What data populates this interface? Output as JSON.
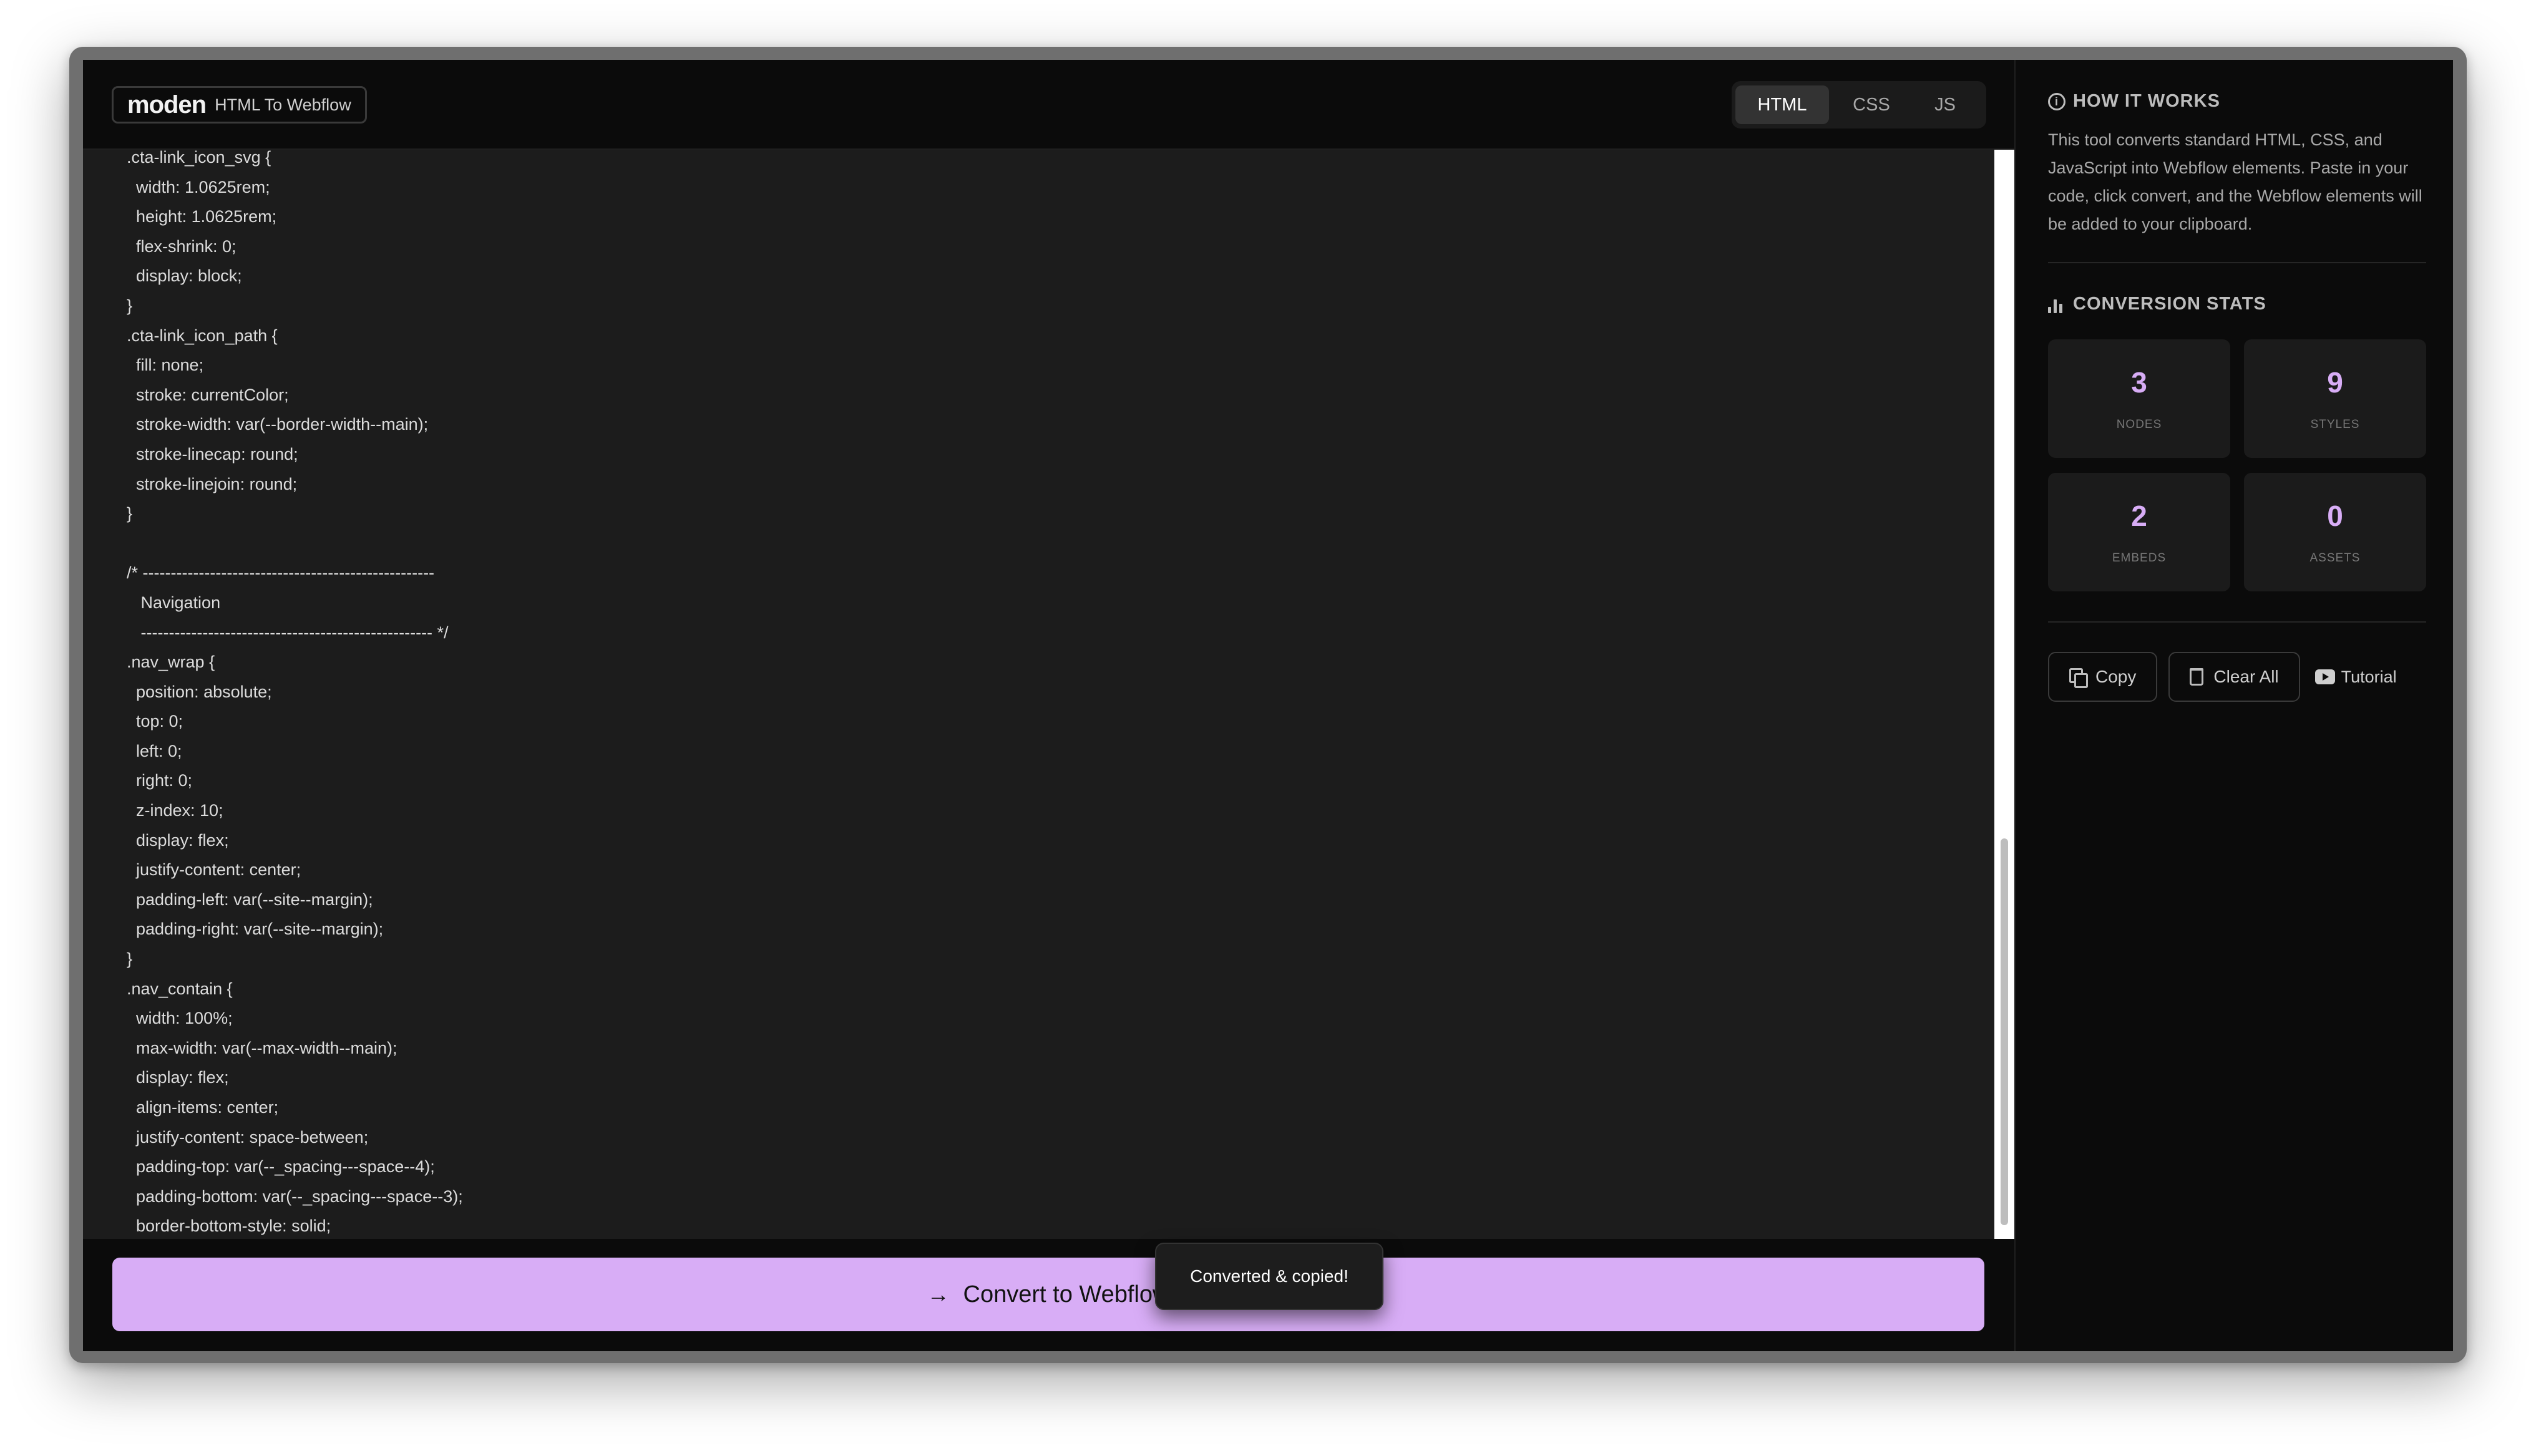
{
  "brand": {
    "logo": "moden",
    "subtitle": "HTML To Webflow"
  },
  "tabs": [
    {
      "label": "HTML",
      "active": true
    },
    {
      "label": "CSS",
      "active": false
    },
    {
      "label": "JS",
      "active": false
    }
  ],
  "editor": {
    "code": ".cta-link_icon_svg {\n  width: 1.0625rem;\n  height: 1.0625rem;\n  flex-shrink: 0;\n  display: block;\n}\n.cta-link_icon_path {\n  fill: none;\n  stroke: currentColor;\n  stroke-width: var(--border-width--main);\n  stroke-linecap: round;\n  stroke-linejoin: round;\n}\n\n/* ----------------------------------------------------\n   Navigation\n   ---------------------------------------------------- */\n.nav_wrap {\n  position: absolute;\n  top: 0;\n  left: 0;\n  right: 0;\n  z-index: 10;\n  display: flex;\n  justify-content: center;\n  padding-left: var(--site--margin);\n  padding-right: var(--site--margin);\n}\n.nav_contain {\n  width: 100%;\n  max-width: var(--max-width--main);\n  display: flex;\n  align-items: center;\n  justify-content: space-between;\n  padding-top: var(--_spacing---space--4);\n  padding-bottom: var(--_spacing---space--3);\n  border-bottom-style: solid;"
  },
  "convert_button": {
    "label": "Convert to Webflow"
  },
  "toast": {
    "text": "Converted & copied!"
  },
  "sidebar": {
    "how_it_works": {
      "title": "HOW IT WORKS",
      "text": "This tool converts standard HTML, CSS, and JavaScript into Webflow elements. Paste in your code, click convert, and the Webflow elements will be added to your clipboard."
    },
    "stats": {
      "title": "CONVERSION STATS",
      "items": [
        {
          "value": "3",
          "label": "NODES"
        },
        {
          "value": "9",
          "label": "STYLES"
        },
        {
          "value": "2",
          "label": "EMBEDS"
        },
        {
          "value": "0",
          "label": "ASSETS"
        }
      ]
    },
    "actions": {
      "copy": "Copy",
      "clear": "Clear All",
      "tutorial": "Tutorial"
    }
  },
  "colors": {
    "accent": "#d8adf6",
    "background": "#0b0b0b",
    "editor_bg": "#1c1c1c"
  },
  "icons": {
    "info": "info-icon",
    "stats": "bar-chart-icon",
    "copy": "copy-icon",
    "clear": "trash-icon",
    "tutorial": "youtube-icon",
    "convert": "arrow-right-icon"
  }
}
